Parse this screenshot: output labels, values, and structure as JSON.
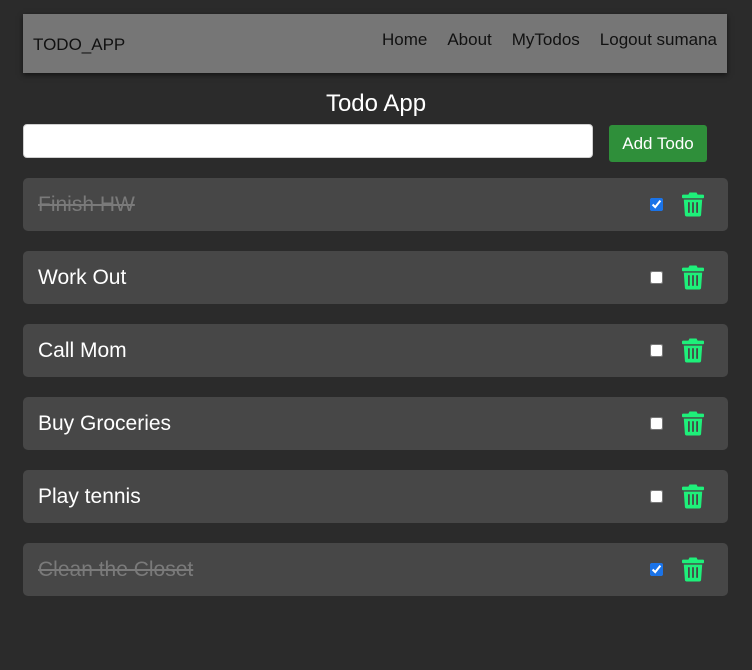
{
  "navbar": {
    "brand": "TODO_APP",
    "links": [
      "Home",
      "About",
      "MyTodos",
      "Logout sumana"
    ]
  },
  "page": {
    "title": "Todo App"
  },
  "form": {
    "input_value": "",
    "add_label": "Add Todo"
  },
  "todos": [
    {
      "text": "Finish HW",
      "done": true
    },
    {
      "text": "Work Out",
      "done": false
    },
    {
      "text": "Call Mom",
      "done": false
    },
    {
      "text": "Buy Groceries",
      "done": false
    },
    {
      "text": "Play tennis",
      "done": false
    },
    {
      "text": "Clean the Closet",
      "done": true
    }
  ],
  "colors": {
    "background": "#2b2b2b",
    "navbar": "#767676",
    "item": "#474747",
    "add_button": "#2f8f3a",
    "trash_icon": "#1ef07a",
    "done_text": "#7a7a7a"
  }
}
